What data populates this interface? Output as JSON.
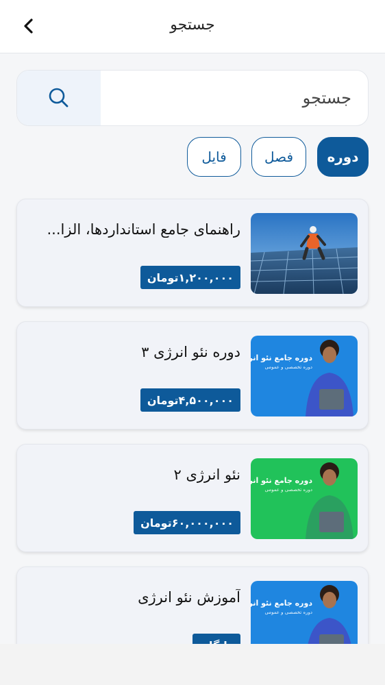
{
  "header": {
    "title": "جستجو",
    "back_icon": "chevron-left-icon"
  },
  "search": {
    "placeholder": "جستجو",
    "value": "",
    "button_icon": "search-icon"
  },
  "filters": [
    {
      "label": "دوره",
      "active": true
    },
    {
      "label": "فصل",
      "active": false
    },
    {
      "label": "فایل",
      "active": false
    }
  ],
  "results": [
    {
      "title": "راهنمای جامع استانداردها، الزا...",
      "price": "۱,۲۰۰,۰۰۰تومان",
      "thumb": "solar-panel-worker"
    },
    {
      "title": "دوره نئو انرژی ۳",
      "price": "۴,۵۰۰,۰۰۰تومان",
      "thumb": "promo-blue",
      "thumb_text": {
        "title": "دوره جامع نئو انرژی",
        "subtitle": "دوره تخصصی و عمومی"
      }
    },
    {
      "title": "نئو انرژی ۲",
      "price": "۶۰,۰۰۰,۰۰۰تومان",
      "thumb": "promo-green",
      "thumb_text": {
        "title": "دوره جامع نئو انرژی",
        "subtitle": "دوره تخصصی و عمومی"
      }
    },
    {
      "title": "آموزش نئو انرژی",
      "price": "رایگان",
      "thumb": "promo-blue",
      "thumb_text": {
        "title": "دوره جامع نئو انرژی",
        "subtitle": "دوره تخصصی و عمومی"
      }
    }
  ],
  "colors": {
    "primary": "#0e5a9a",
    "promo_blue": "#1f86e0",
    "promo_green": "#21c25a",
    "background": "#f5f6f8"
  }
}
